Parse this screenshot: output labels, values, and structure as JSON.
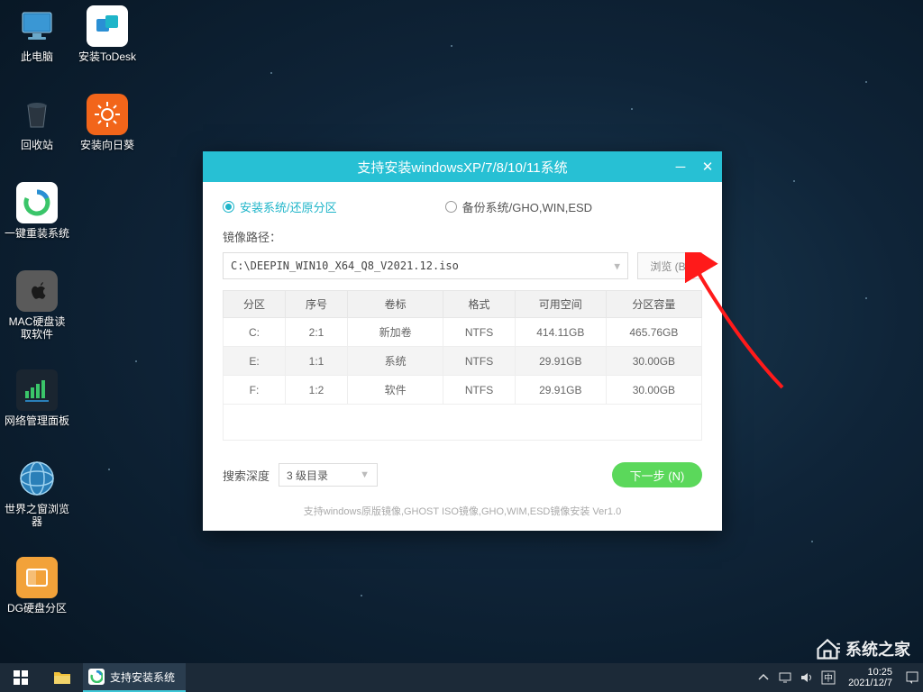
{
  "desktop_icons": [
    {
      "label": "此电脑"
    },
    {
      "label": "安装ToDesk"
    },
    {
      "label": "回收站"
    },
    {
      "label": "安装向日葵"
    },
    {
      "label": "一键重装系统"
    },
    {
      "label": "MAC硬盘读取软件"
    },
    {
      "label": "网络管理面板"
    },
    {
      "label": "世界之窗浏览器"
    },
    {
      "label": "DG硬盘分区"
    }
  ],
  "window": {
    "title": "支持安装windowsXP/7/8/10/11系统",
    "radio_install": "安装系统/还原分区",
    "radio_backup": "备份系统/GHO,WIN,ESD",
    "path_label": "镜像路径：",
    "path_value": "C:\\DEEPIN_WIN10_X64_Q8_V2021.12.iso",
    "browse": "浏览 (B)",
    "headers": [
      "分区",
      "序号",
      "卷标",
      "格式",
      "可用空间",
      "分区容量"
    ],
    "rows": [
      [
        "C:",
        "2:1",
        "新加卷",
        "NTFS",
        "414.11GB",
        "465.76GB"
      ],
      [
        "E:",
        "1:1",
        "系统",
        "NTFS",
        "29.91GB",
        "30.00GB"
      ],
      [
        "F:",
        "1:2",
        "软件",
        "NTFS",
        "29.91GB",
        "30.00GB"
      ]
    ],
    "depth_label": "搜索深度",
    "depth_value": "3 级目录",
    "next": "下一步 (N)",
    "footer": "支持windows原版镜像,GHOST ISO镜像,GHO,WIM,ESD镜像安装 Ver1.0"
  },
  "taskbar": {
    "task": "支持安装系统",
    "time": "10:25",
    "date": "2021/12/7"
  },
  "watermark": "系统之家"
}
